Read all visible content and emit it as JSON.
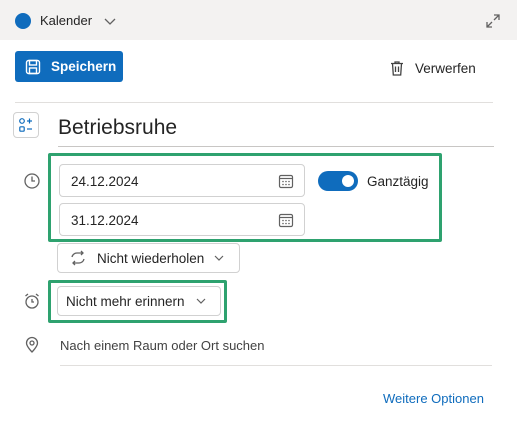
{
  "header": {
    "calendar_label": "Kalender",
    "calendar_color": "#0f6cbd",
    "expand_icon": "expand-diagonal-icon"
  },
  "toolbar": {
    "save_label": "Speichern",
    "save_icon": "floppy-disk-icon",
    "discard_label": "Verwerfen",
    "discard_icon": "trash-icon"
  },
  "event": {
    "title": "Betriebsruhe",
    "title_icon": "category-icon"
  },
  "time": {
    "start_date": "24.12.2024",
    "end_date": "31.12.2024",
    "all_day_label": "Ganztägig",
    "all_day_on": true,
    "repeat_label": "Nicht wiederholen"
  },
  "reminder": {
    "label": "Nicht mehr erinnern"
  },
  "location": {
    "placeholder": "Nach einem Raum oder Ort suchen"
  },
  "footer": {
    "more_options": "Weitere Optionen"
  },
  "colors": {
    "accent": "#0f6cbd",
    "highlight": "#2ea26f"
  }
}
